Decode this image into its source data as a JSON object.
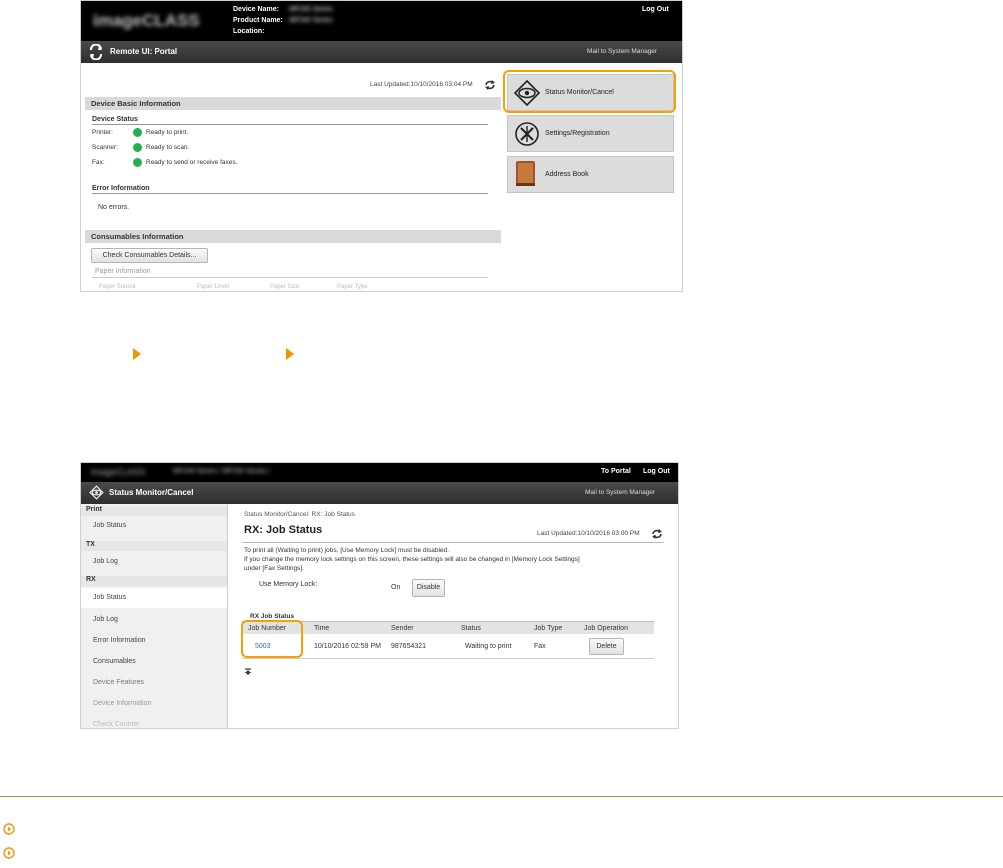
{
  "portal": {
    "logo_text": "imageCLASS",
    "device_name_label": "Device Name:",
    "device_name_value": "MF240 Series",
    "product_name_label": "Product Name:",
    "product_name_value": "MF240 Series",
    "location_label": "Location:",
    "logout": "Log Out",
    "title": "Remote UI: Portal",
    "mail_link": "Mail to System Manager",
    "last_updated": "Last Updated:10/10/2016 03:04 PM",
    "device_basic_info": "Device Basic Information",
    "device_status": "Device Status",
    "status_rows": [
      {
        "label": "Printer:",
        "value": "Ready to print."
      },
      {
        "label": "Scanner:",
        "value": "Ready to scan."
      },
      {
        "label": "Fax:",
        "value": "Ready to send or receive faxes."
      }
    ],
    "error_info": "Error Information",
    "no_errors": "No errors.",
    "consumables_info": "Consumables Information",
    "check_consumables": "Check Consumables Details...",
    "paper_info": "Paper Information",
    "paper_cols": [
      "Paper Source",
      "Paper Level",
      "Paper Size",
      "Paper Type"
    ],
    "menu": [
      {
        "label": "Status Monitor/Cancel",
        "icon": "eye-icon"
      },
      {
        "label": "Settings/Registration",
        "icon": "gear-icon"
      },
      {
        "label": "Address Book",
        "icon": "book-icon"
      }
    ]
  },
  "status": {
    "breadcrumb_top": "MF240 Series / MF240 Series /",
    "to_portal": "To Portal",
    "logout": "Log Out",
    "title": "Status Monitor/Cancel",
    "mail_link": "Mail to System Manager",
    "sidebar": [
      {
        "type": "head",
        "label": "Print"
      },
      {
        "type": "item",
        "label": "Job Status"
      },
      {
        "type": "head",
        "label": "TX"
      },
      {
        "type": "item",
        "label": "Job Log"
      },
      {
        "type": "head",
        "label": "RX"
      },
      {
        "type": "item",
        "label": "Job Status",
        "active": true
      },
      {
        "type": "item",
        "label": "Job Log"
      },
      {
        "type": "item",
        "label": "Error Information"
      },
      {
        "type": "item",
        "label": "Consumables"
      },
      {
        "type": "item",
        "label": "Device Features"
      },
      {
        "type": "item",
        "label": "Device Information"
      },
      {
        "type": "item",
        "label": "Check Counter"
      }
    ],
    "breadcrumb": "Status Monitor/Cancel: RX: Job Status",
    "page_title": "RX: Job Status",
    "last_updated": "Last Updated:10/10/2016 03:00 PM",
    "notice_lines": [
      "To print all (Waiting to print) jobs, [Use Memory Lock] must be disabled.",
      "If you change the memory lock settings on this screen, these settings will also be changed in [Memory Lock Settings]",
      "under [Fax Settings]."
    ],
    "memory_lock_label": "Use Memory Lock:",
    "memory_lock_value": "On",
    "disable_btn": "Disable",
    "rx_job_status": "RX Job Status",
    "columns": [
      "Job Number",
      "Time",
      "Sender",
      "Status",
      "Job Type",
      "Job Operation"
    ],
    "row": {
      "job_number": "5003",
      "time": "10/10/2016 02:59 PM",
      "sender": "987654321",
      "status": "Waiting to print",
      "job_type": "Fax",
      "op": "Delete"
    }
  },
  "colors": {
    "highlight": "#f5a100",
    "link": "#2a6ebb",
    "ready": "#22b14c",
    "arrow": "#f29400"
  }
}
